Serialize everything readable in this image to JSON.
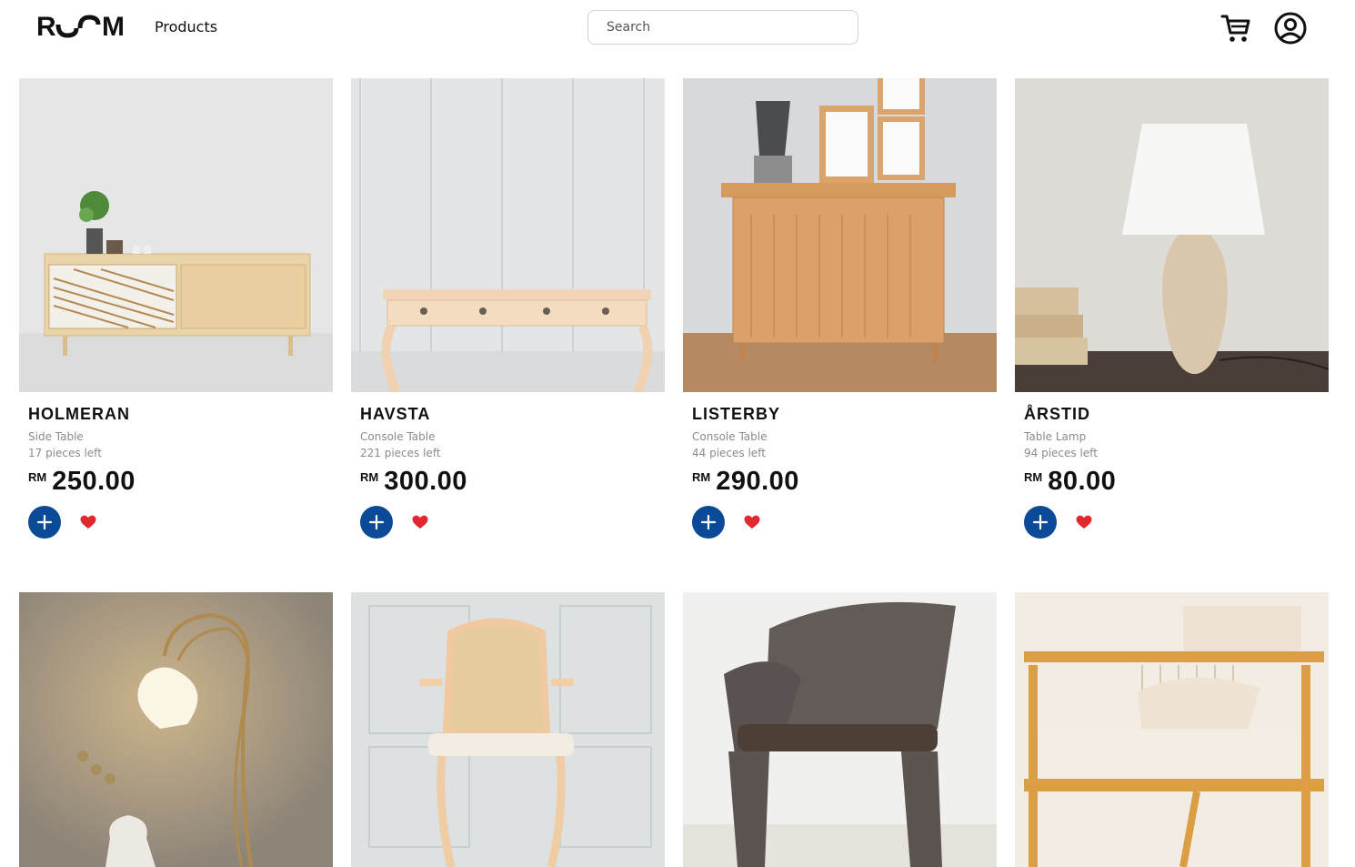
{
  "header": {
    "logo": "ROOM",
    "nav_products": "Products",
    "search_placeholder": "Search",
    "cart_icon": "cart-icon",
    "account_icon": "user-circle-icon"
  },
  "colors": {
    "accent": "#0a4a96",
    "heart": "#e0282e"
  },
  "products": [
    {
      "name": "HOLMERAN",
      "category": "Side Table",
      "stock": "17 pieces left",
      "currency": "RM",
      "price": "250.00"
    },
    {
      "name": "HAVSTA",
      "category": "Console Table",
      "stock": "221 pieces left",
      "currency": "RM",
      "price": "300.00"
    },
    {
      "name": "LISTERBY",
      "category": "Console Table",
      "stock": "44 pieces left",
      "currency": "RM",
      "price": "290.00"
    },
    {
      "name": "ÅRSTID",
      "category": "Table Lamp",
      "stock": "94 pieces left",
      "currency": "RM",
      "price": "80.00"
    }
  ]
}
